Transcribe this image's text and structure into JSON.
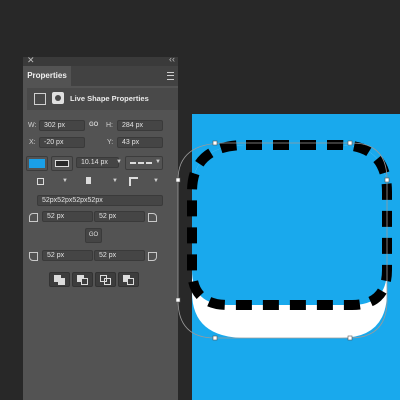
{
  "panel": {
    "close_glyph": "✕",
    "collapse_glyph": "‹‹",
    "tab_label": "Properties",
    "menu_icon": "menu-icon",
    "section_title": "Live Shape Properties",
    "w_label": "W:",
    "w_value": "302 px",
    "h_label": "H:",
    "h_value": "284 px",
    "x_label": "X:",
    "x_value": "-20 px",
    "y_label": "Y:",
    "y_value": "43 px",
    "link_glyph": "GO",
    "fill_color": "#1aa0e8",
    "stroke_width": "10.14 px",
    "radii_string": "52px52px52px52px",
    "radius_tl": "52 px",
    "radius_tr": "52 px",
    "radius_bl": "52 px",
    "radius_br": "52 px"
  },
  "canvas": {
    "background": "#19a9ed",
    "shape_fill": "#ffffff",
    "stroke_color": "#000000"
  }
}
